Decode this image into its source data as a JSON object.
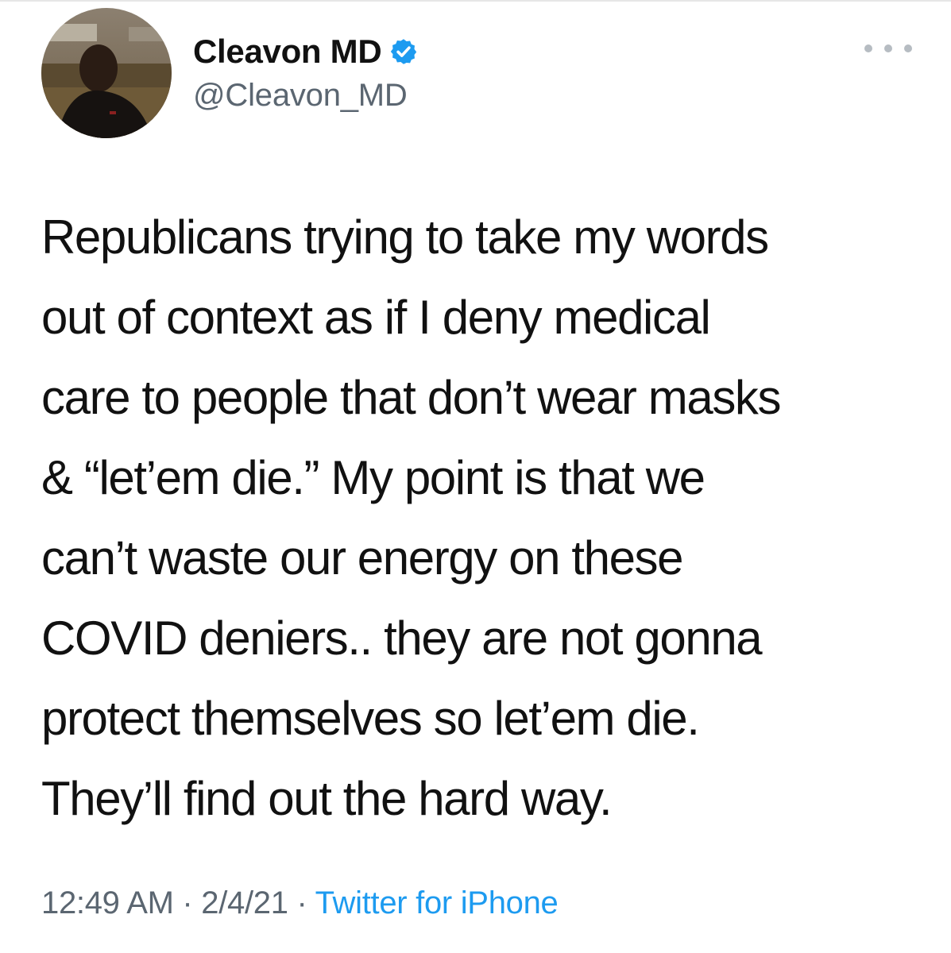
{
  "author": {
    "display_name": "Cleavon MD",
    "handle": "@Cleavon_MD",
    "verified": true,
    "verified_icon": "verified-badge-icon",
    "avatar_icon": "profile-photo"
  },
  "menu": {
    "icon": "more-options-icon"
  },
  "tweet": {
    "lines": [
      "Republicans trying to take my words",
      "out of context as if I deny medical",
      "care to people that don’t wear masks",
      "& “let’em die.” My point is that we",
      "can’t waste our energy on these",
      "COVID deniers.. they are not gonna",
      "protect themselves so let’em die.",
      "They’ll find out the hard way."
    ]
  },
  "meta": {
    "time": "12:49 AM",
    "separator": " · ",
    "date": "2/4/21",
    "source": "Twitter for iPhone"
  },
  "colors": {
    "text": "#111111",
    "secondary": "#5b6671",
    "link": "#1d9bf0",
    "verified": "#1d9bf0"
  }
}
